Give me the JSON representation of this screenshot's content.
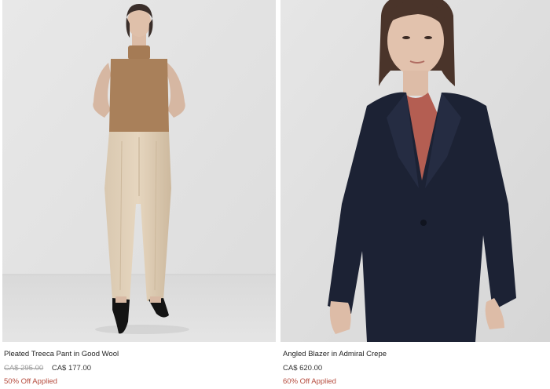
{
  "products": [
    {
      "name": "Pleated Treeca Pant in Good Wool",
      "original_price": "CA$ 295.00",
      "sale_price": "CA$ 177.00",
      "promo": "50% Off Applied",
      "image": "model-in-sleeveless-turtleneck-and-beige-pleated-pants"
    },
    {
      "name": "Angled Blazer in Admiral Crepe",
      "original_price": "",
      "sale_price": "CA$ 620.00",
      "promo": "60% Off Applied",
      "image": "model-in-navy-blazer-over-rust-top"
    }
  ],
  "colors": {
    "promo": "#b54a3c",
    "strike": "#9e9e9e",
    "text": "#222222"
  }
}
